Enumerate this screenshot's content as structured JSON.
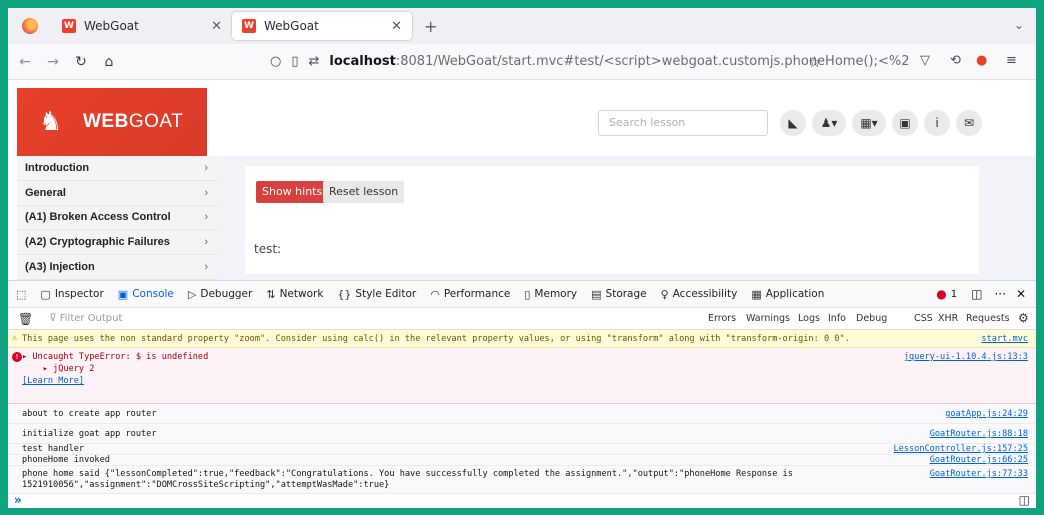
{
  "tabs": [
    {
      "title": "WebGoat"
    },
    {
      "title": "WebGoat"
    }
  ],
  "url": {
    "host": "localhost",
    "rest": ":8081/WebGoat/start.mvc#test/<script>webgoat.customjs.phoneHome();<%2"
  },
  "brand": {
    "name_bold": "WEB",
    "name_rest": "GOAT"
  },
  "search_placeholder": "Search lesson",
  "menu": [
    "Introduction",
    "General",
    "(A1) Broken Access Control",
    "(A2) Cryptographic Failures",
    "(A3) Injection"
  ],
  "buttons": {
    "show_hints": "Show hints",
    "reset_lesson": "Reset lesson"
  },
  "lesson_text": "test:",
  "devtools": {
    "tools": [
      "Inspector",
      "Console",
      "Debugger",
      "Network",
      "Style Editor",
      "Performance",
      "Memory",
      "Storage",
      "Accessibility",
      "Application"
    ],
    "selected": "Console",
    "error_count": "1",
    "filter_placeholder": "Filter Output",
    "levels": [
      "Errors",
      "Warnings",
      "Logs",
      "Info",
      "Debug"
    ],
    "extras": [
      "CSS",
      "XHR",
      "Requests"
    ]
  },
  "console": {
    "warning": {
      "text": "This page uses the non standard property \"zoom\". Consider using calc() in the relevant property values, or using \"transform\" along with \"transform-origin: 0 0\".",
      "source": "start.mvc"
    },
    "error": {
      "line1": "▸ Uncaught TypeError: $ is undefined",
      "line2": "    ▸ jQuery 2",
      "link": "[Learn More]",
      "source": "jquery-ui-1.10.4.js:13:3"
    },
    "logs": [
      {
        "text": "about to create app router",
        "source": "goatApp.js:24:29"
      },
      {
        "text": "initialize goat app router",
        "source": "GoatRouter.js:88:18"
      },
      {
        "text": "test handler",
        "source": "LessonController.js:157:25"
      },
      {
        "text": "phoneHome invoked",
        "source": "GoatRouter.js:66:25"
      }
    ],
    "phone": {
      "line1": "phone home said {\"lessonCompleted\":true,\"feedback\":\"Congratulations. You have successfully completed the assignment.\",\"output\":\"phoneHome Response is",
      "line2": "1521910056\",\"assignment\":\"DOMCrossSiteScripting\",\"attemptWasMade\":true}",
      "source": "GoatRouter.js:77:33"
    }
  }
}
